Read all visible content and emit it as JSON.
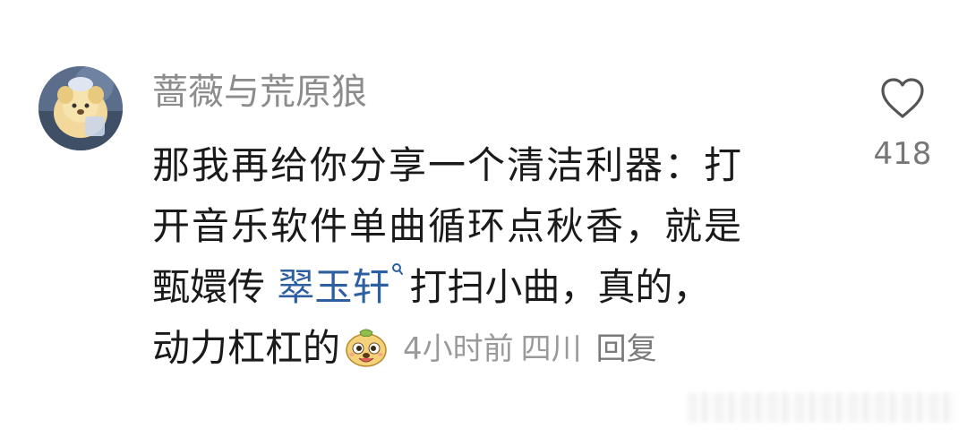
{
  "comment": {
    "username": "蔷薇与荒原狼",
    "line1": "那我再给你分享一个清洁利器：打",
    "line2": "开音乐软件单曲循环点秋香，就是",
    "line3_prefix": "甄嬛传 ",
    "link_text": "翠玉轩",
    "line3_suffix": "打扫小曲，真的，",
    "line4": "动力杠杠的",
    "emoji_icon": "grinning-dog-face-icon",
    "time": "4小时前",
    "location": "四川",
    "reply_label": "回复",
    "likes": "418"
  },
  "colors": {
    "username": "#8c8c8c",
    "text": "#1a1a1a",
    "link": "#2d5fa0",
    "meta": "#9a9a9a"
  }
}
